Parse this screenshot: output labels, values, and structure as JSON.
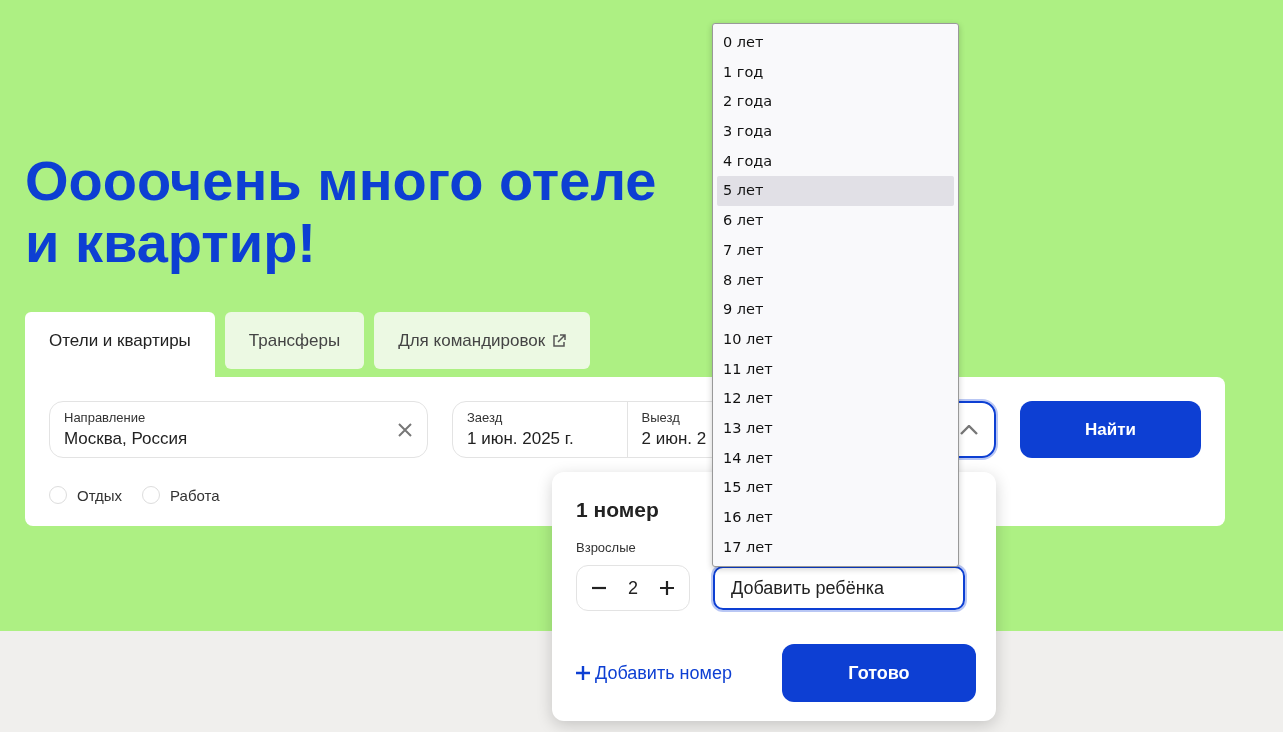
{
  "hero": {
    "title_lines": [
      "Оооочень много отеле",
      "и квартир!"
    ]
  },
  "tabs": [
    {
      "label": "Отели и квартиры",
      "selected": true,
      "kind": "plain"
    },
    {
      "label": "Трансферы",
      "selected": false,
      "kind": "plain"
    },
    {
      "label": "Для командировок",
      "selected": false,
      "kind": "external"
    }
  ],
  "search_form": {
    "destination": {
      "label": "Направление",
      "value": "Москва, Россия"
    },
    "check_in": {
      "label": "Заезд",
      "value": "1 июн. 2025 г."
    },
    "check_out": {
      "label": "Выезд",
      "value": "2 июн. 2"
    },
    "guests": {
      "expanded": true
    },
    "search_button": "Найти",
    "trip_purpose": [
      {
        "label": "Отдых",
        "selected": false
      },
      {
        "label": "Работа",
        "selected": false
      }
    ]
  },
  "rooms_popover": {
    "title": "1 номер",
    "adults": {
      "label": "Взрослые",
      "value": "2"
    },
    "add_child": {
      "value": "Добавить ребёнка",
      "focused": true
    },
    "add_room": "Добавить номер",
    "done_button": "Готово"
  },
  "age_dropdown": {
    "options": [
      {
        "label": "0 лет",
        "selected": false
      },
      {
        "label": "1 год",
        "selected": false
      },
      {
        "label": "2 года",
        "selected": false
      },
      {
        "label": "3 года",
        "selected": false
      },
      {
        "label": "4 года",
        "selected": false
      },
      {
        "label": "5 лет",
        "selected": true
      },
      {
        "label": "6 лет",
        "selected": false
      },
      {
        "label": "7 лет",
        "selected": false
      },
      {
        "label": "8 лет",
        "selected": false
      },
      {
        "label": "9 лет",
        "selected": false
      },
      {
        "label": "10 лет",
        "selected": false
      },
      {
        "label": "11 лет",
        "selected": false
      },
      {
        "label": "12 лет",
        "selected": false
      },
      {
        "label": "13 лет",
        "selected": false
      },
      {
        "label": "14 лет",
        "selected": false
      },
      {
        "label": "15 лет",
        "selected": false
      },
      {
        "label": "16 лет",
        "selected": false
      },
      {
        "label": "17 лет",
        "selected": false
      }
    ]
  }
}
